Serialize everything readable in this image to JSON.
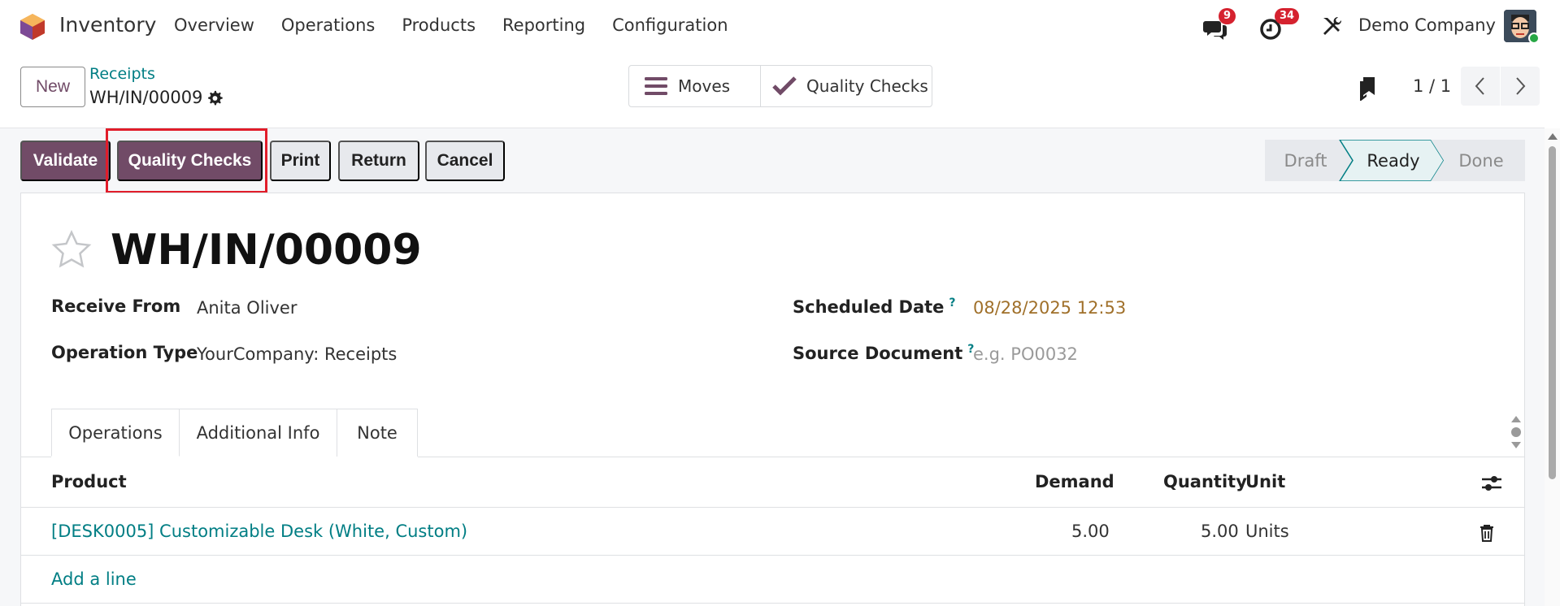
{
  "nav": {
    "app_name": "Inventory",
    "menu": [
      "Overview",
      "Operations",
      "Products",
      "Reporting",
      "Configuration"
    ],
    "messages_count": "9",
    "activities_count": "34",
    "company": "Demo Company"
  },
  "control": {
    "new_label": "New",
    "breadcrumb_parent": "Receipts",
    "breadcrumb_current": "WH/IN/00009",
    "smart_moves": "Moves",
    "smart_quality_checks": "Quality Checks",
    "pager": "1 / 1"
  },
  "actions": {
    "validate": "Validate",
    "quality_checks": "Quality Checks",
    "print": "Print",
    "return": "Return",
    "cancel": "Cancel"
  },
  "status": {
    "steps": [
      "Draft",
      "Ready",
      "Done"
    ],
    "current": "Ready"
  },
  "record": {
    "title": "WH/IN/00009",
    "receive_from_label": "Receive From",
    "receive_from": "Anita Oliver",
    "operation_type_label": "Operation Type",
    "operation_type": "YourCompany: Receipts",
    "scheduled_date_label": "Scheduled Date",
    "scheduled_date": "08/28/2025 12:53",
    "source_document_label": "Source Document",
    "source_document_placeholder": "e.g. PO0032",
    "help_mark": "?"
  },
  "tabs": [
    "Operations",
    "Additional Info",
    "Note"
  ],
  "table": {
    "headers": {
      "product": "Product",
      "demand": "Demand",
      "quantity": "Quantity",
      "unit": "Unit"
    },
    "rows": [
      {
        "product": "[DESK0005] Customizable Desk (White, Custom)",
        "demand": "5.00",
        "quantity": "5.00",
        "unit": "Units"
      }
    ],
    "add_line": "Add a line"
  },
  "colors": {
    "primary": "#714b67",
    "link": "#017e84",
    "date": "#a0702a",
    "highlight": "#e11d2a"
  }
}
